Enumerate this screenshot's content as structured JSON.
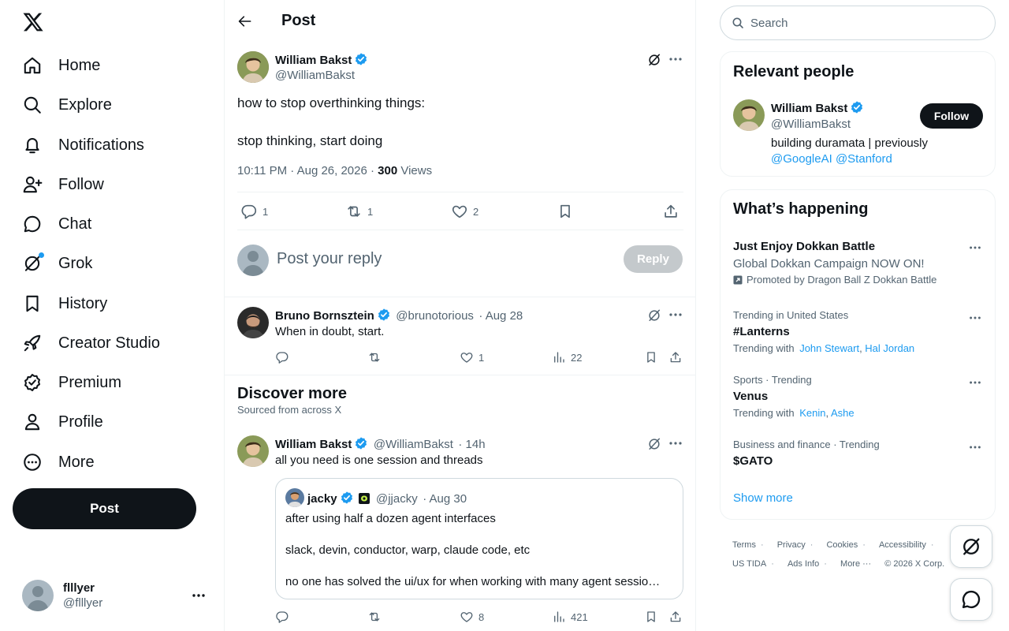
{
  "sidebar": {
    "items": [
      {
        "label": "Home",
        "icon": "home-icon"
      },
      {
        "label": "Explore",
        "icon": "search-icon"
      },
      {
        "label": "Notifications",
        "icon": "bell-icon"
      },
      {
        "label": "Follow",
        "icon": "person-add-icon"
      },
      {
        "label": "Chat",
        "icon": "chat-icon"
      },
      {
        "label": "Grok",
        "icon": "grok-icon"
      },
      {
        "label": "History",
        "icon": "bookmark-icon"
      },
      {
        "label": "Creator Studio",
        "icon": "rocket-icon"
      },
      {
        "label": "Premium",
        "icon": "verified-badge-icon"
      },
      {
        "label": "Profile",
        "icon": "person-icon"
      },
      {
        "label": "More",
        "icon": "more-circle-icon"
      }
    ],
    "post_label": "Post",
    "account": {
      "name": "flllyer",
      "handle": "@flllyer"
    }
  },
  "header": {
    "title": "Post"
  },
  "main_post": {
    "author_name": "William Bakst",
    "author_handle": "@WilliamBakst",
    "text_line1": "how to stop overthinking things:",
    "text_line2": "stop thinking, start doing",
    "timestamp": "10:11 PM · Aug 26, 2026 · ",
    "views_count": "300",
    "views_label": " Views",
    "replies": "1",
    "reposts": "1",
    "likes": "2"
  },
  "reply_box": {
    "placeholder": "Post your reply",
    "button": "Reply"
  },
  "reply": {
    "author_name": "Bruno Bornsztein",
    "author_handle": "@brunotorious",
    "date": "· Aug 28",
    "text": "When in doubt, start.",
    "likes": "1",
    "views": "22"
  },
  "discover": {
    "title": "Discover more",
    "subtitle": "Sourced from across X"
  },
  "discover_post": {
    "author_name": "William Bakst",
    "author_handle": "@WilliamBakst",
    "date": "· 14h",
    "text": "all you need is one session and threads",
    "likes": "8",
    "views": "421",
    "quote": {
      "author_name": "jacky",
      "author_handle": "@jjacky",
      "date": "· Aug 30",
      "line1": "after using half a dozen agent interfaces",
      "line2": "slack, devin, conductor, warp, claude code, etc",
      "line3": "no one has solved the ui/ux for when working with many agent sessio…"
    }
  },
  "right": {
    "search_placeholder": "Search",
    "relevant": {
      "title": "Relevant people",
      "name": "William Bakst",
      "handle": "@WilliamBakst",
      "follow": "Follow",
      "bio": "building duramata | previously",
      "bio_link1": "@GoogleAI",
      "bio_link2": "@Stanford"
    },
    "happening": {
      "title": "What’s happening",
      "promo": {
        "name": "Just Enjoy Dokkan Battle",
        "desc": "Global Dokkan Campaign NOW ON!",
        "promoted": "Promoted by Dragon Ball Z Dokkan Battle"
      },
      "trends": [
        {
          "context": "Trending in United States",
          "name": "#Lanterns",
          "with_label": "Trending with",
          "with1": "John Stewart",
          "with2": "Hal Jordan"
        },
        {
          "context": "Sports · Trending",
          "name": "Venus",
          "with_label": "Trending with",
          "with1": "Kenin",
          "with2": "Ashe"
        },
        {
          "context": "Business and finance · Trending",
          "name": "$GATO",
          "with_label": "",
          "with1": "",
          "with2": ""
        }
      ],
      "show_more": "Show more"
    },
    "footer": {
      "links": [
        "Terms",
        "Privacy",
        "Cookies",
        "Accessibility",
        "US TIDA",
        "Ads Info",
        "More ···"
      ],
      "copyright": "© 2026 X Corp."
    }
  },
  "colors": {
    "accent": "#1d9bf0",
    "text": "#0f1419",
    "muted": "#536471",
    "border": "#eff3f4"
  }
}
